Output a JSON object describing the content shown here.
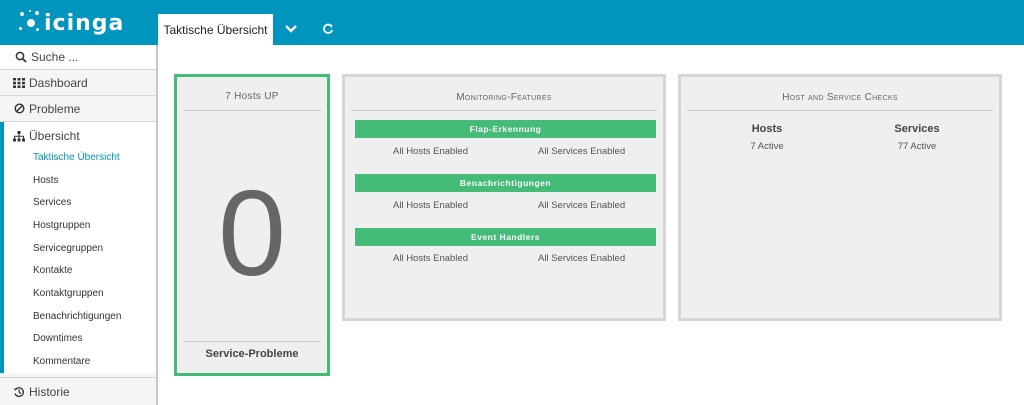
{
  "app": {
    "logo_text": "icinga"
  },
  "tabs": [
    {
      "label": "Taktische Übersicht"
    }
  ],
  "tab_controls": {
    "dropdown_icon": "chevron-down-icon",
    "refresh_icon": "refresh-icon"
  },
  "sidebar": {
    "search_placeholder": "Suche ...",
    "dashboard": "Dashboard",
    "probleme": "Probleme",
    "uebersicht": "Übersicht",
    "sub_items": [
      {
        "label": "Taktische Übersicht",
        "active": true
      },
      {
        "label": "Hosts"
      },
      {
        "label": "Services"
      },
      {
        "label": "Hostgruppen"
      },
      {
        "label": "Servicegruppen"
      },
      {
        "label": "Kontakte"
      },
      {
        "label": "Kontaktgruppen"
      },
      {
        "label": "Benachrichtigungen"
      },
      {
        "label": "Downtimes"
      },
      {
        "label": "Kommentare"
      }
    ],
    "historie": "Historie"
  },
  "hosts_panel": {
    "title": "7 Hosts UP",
    "big_number": "0",
    "footer": "Service-Probleme"
  },
  "monitoring_panel": {
    "title": "Monitoring-Features",
    "features": [
      {
        "name": "Flap-Erkennung",
        "hosts": "All Hosts Enabled",
        "services": "All Services Enabled"
      },
      {
        "name": "Benachrichtigungen",
        "hosts": "All Hosts Enabled",
        "services": "All Services Enabled"
      },
      {
        "name": "Event Handlers",
        "hosts": "All Hosts Enabled",
        "services": "All Services Enabled"
      }
    ]
  },
  "checks_panel": {
    "title": "Host and Service Checks",
    "hosts_label": "Hosts",
    "hosts_value": "7 Active",
    "services_label": "Services",
    "services_value": "77 Active"
  },
  "colors": {
    "brand": "#0095bf",
    "ok_green": "#44bb77",
    "panel_bg": "#efefef"
  }
}
